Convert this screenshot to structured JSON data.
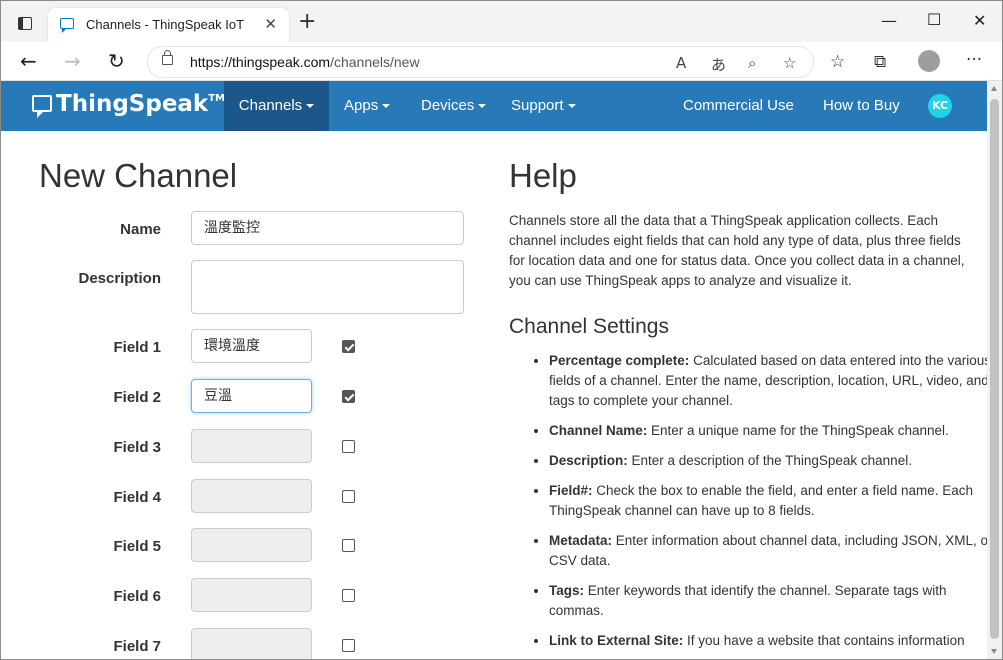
{
  "browser": {
    "tab_title": "Channels - ThingSpeak IoT",
    "tab_close": "✕",
    "new_tab": "+",
    "url_host": "https://thingspeak.com",
    "url_path": "/channels/new",
    "win_minimize": "—",
    "win_maximize": "☐",
    "win_close": "✕",
    "back": "←",
    "forward": "→",
    "reload": "↻",
    "more": "···"
  },
  "nav": {
    "brand": "ThingSpeak",
    "brand_tm": "TM",
    "items": [
      "Channels",
      "Apps",
      "Devices",
      "Support"
    ],
    "right_items": [
      "Commercial Use",
      "How to Buy"
    ],
    "user_initials": "KC"
  },
  "form": {
    "title": "New Channel",
    "name_label": "Name",
    "name_value": "溫度監控",
    "description_label": "Description",
    "description_value": "",
    "fields": [
      {
        "label": "Field 1",
        "value": "環境溫度",
        "checked": true
      },
      {
        "label": "Field 2",
        "value": "豆溫",
        "checked": true
      },
      {
        "label": "Field 3",
        "value": "",
        "checked": false
      },
      {
        "label": "Field 4",
        "value": "",
        "checked": false
      },
      {
        "label": "Field 5",
        "value": "",
        "checked": false
      },
      {
        "label": "Field 6",
        "value": "",
        "checked": false
      },
      {
        "label": "Field 7",
        "value": "",
        "checked": false
      }
    ]
  },
  "help": {
    "title": "Help",
    "intro": "Channels store all the data that a ThingSpeak application collects. Each channel includes eight fields that can hold any type of data, plus three fields for location data and one for status data. Once you collect data in a channel, you can use ThingSpeak apps to analyze and visualize it.",
    "settings_title": "Channel Settings",
    "settings": [
      {
        "term": "Percentage complete:",
        "desc": " Calculated based on data entered into the various fields of a channel. Enter the name, description, location, URL, video, and tags to complete your channel."
      },
      {
        "term": "Channel Name:",
        "desc": " Enter a unique name for the ThingSpeak channel."
      },
      {
        "term": "Description:",
        "desc": " Enter a description of the ThingSpeak channel."
      },
      {
        "term": "Field#:",
        "desc": " Check the box to enable the field, and enter a field name. Each ThingSpeak channel can have up to 8 fields."
      },
      {
        "term": "Metadata:",
        "desc": " Enter information about channel data, including JSON, XML, or CSV data."
      },
      {
        "term": "Tags:",
        "desc": " Enter keywords that identify the channel. Separate tags with commas."
      },
      {
        "term": "Link to External Site:",
        "desc": " If you have a website that contains information"
      }
    ]
  },
  "colors": {
    "navbar": "#2879b8",
    "navbar_active": "#1b5788",
    "avatar": "#22d3e6"
  }
}
